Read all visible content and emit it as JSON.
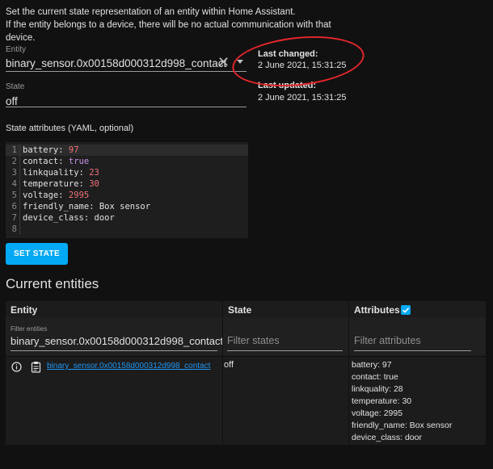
{
  "intro": {
    "line1": "Set the current state representation of an entity within Home Assistant.",
    "line2": "If the entity belongs to a device, there will be no actual communication with that device."
  },
  "form": {
    "entity_label": "Entity",
    "entity_value": "binary_sensor.0x00158d000312d998_contact",
    "state_label": "State",
    "state_value": "off",
    "attributes_label": "State attributes (YAML, optional)",
    "set_state_button": "SET STATE"
  },
  "info": {
    "last_changed_label": "Last changed:",
    "last_changed_value": "2 June 2021, 15:31:25",
    "last_updated_label": "Last updated:",
    "last_updated_value": "2 June 2021, 15:31:25"
  },
  "editor_lines": [
    {
      "n": "1",
      "key": "battery",
      "val": "97",
      "type": "num"
    },
    {
      "n": "2",
      "key": "contact",
      "val": "true",
      "type": "bool"
    },
    {
      "n": "3",
      "key": "linkquality",
      "val": "23",
      "type": "num"
    },
    {
      "n": "4",
      "key": "temperature",
      "val": "30",
      "type": "num"
    },
    {
      "n": "5",
      "key": "voltage",
      "val": "2995",
      "type": "num"
    },
    {
      "n": "6",
      "key": "friendly_name",
      "val": "Box sensor",
      "type": "str"
    },
    {
      "n": "7",
      "key": "device_class",
      "val": "door",
      "type": "str"
    },
    {
      "n": "8",
      "key": "",
      "val": "",
      "type": "empty"
    }
  ],
  "entities": {
    "title": "Current entities",
    "col_entity": "Entity",
    "col_state": "State",
    "col_attributes": "Attributes",
    "filter_entities_label": "Filter entities",
    "filter_entities_value": "binary_sensor.0x00158d000312d998_contact",
    "filter_states_placeholder": "Filter states",
    "filter_attributes_placeholder": "Filter attributes",
    "row": {
      "entity_id": "binary_sensor.0x00158d000312d998_contact",
      "state": "off",
      "attributes": [
        "battery: 97",
        "contact: true",
        "linkquality: 28",
        "temperature: 30",
        "voltage: 2995",
        "friendly_name: Box sensor",
        "device_class: door"
      ]
    }
  },
  "colors": {
    "accent": "#03a9f4",
    "annotation": "#e4262b"
  }
}
